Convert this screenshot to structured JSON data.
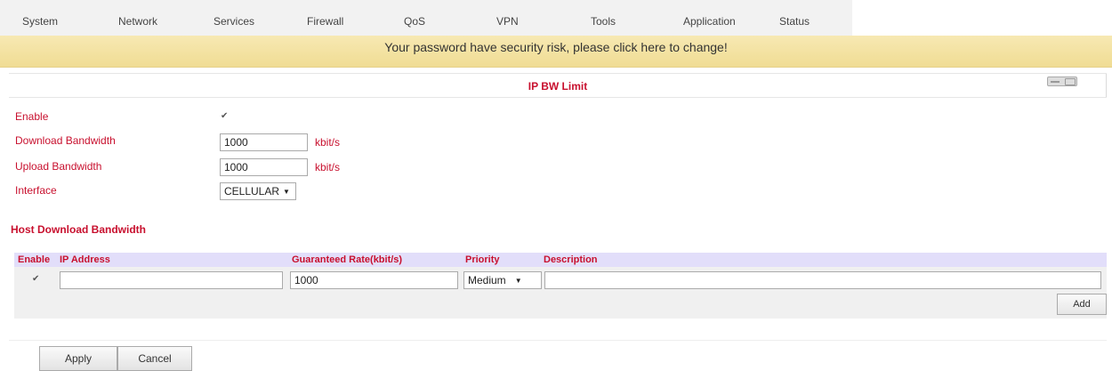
{
  "nav": {
    "items": [
      "System",
      "Network",
      "Services",
      "Firewall",
      "QoS",
      "VPN",
      "Tools",
      "Application",
      "Status"
    ]
  },
  "warning": {
    "text": "Your password have security risk, please click here to change!"
  },
  "section": {
    "title": "IP BW Limit"
  },
  "form": {
    "enable_label": "Enable",
    "enable_checked": true,
    "download_label": "Download Bandwidth",
    "download_value": "1000",
    "download_unit": "kbit/s",
    "upload_label": "Upload Bandwidth",
    "upload_value": "1000",
    "upload_unit": "kbit/s",
    "interface_label": "Interface",
    "interface_value": "CELLULAR"
  },
  "host_table": {
    "title": "Host Download Bandwidth",
    "headers": [
      "Enable",
      "IP Address",
      "Guaranteed Rate(kbit/s)",
      "Priority",
      "Description"
    ],
    "rows": [
      {
        "enabled": true,
        "ip": "",
        "rate": "1000",
        "priority": "Medium",
        "description": ""
      }
    ],
    "add_label": "Add"
  },
  "actions": {
    "apply_label": "Apply",
    "cancel_label": "Cancel"
  },
  "colors": {
    "label_red": "#c8102e",
    "warning_bg": "#f7e9b3",
    "table_header_bg": "#e2defa"
  },
  "icons": {
    "checkbox": "check-mark",
    "select": "caret-down-icon",
    "window": "window-controls-icon"
  }
}
